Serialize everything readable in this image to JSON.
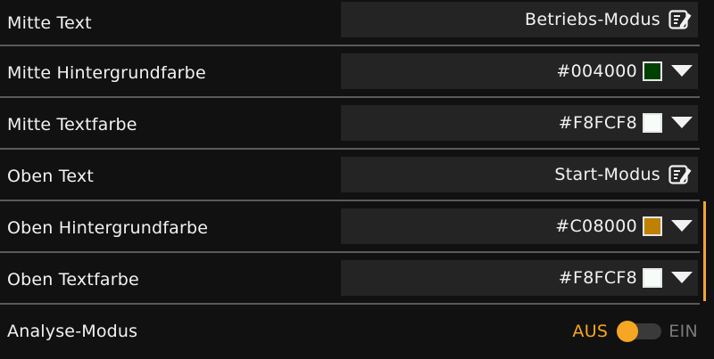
{
  "rows": [
    {
      "label": "Mitte Text",
      "value": "Betriebs-Modus",
      "kind": "text",
      "icon": "edit-icon"
    },
    {
      "label": "Mitte Hintergrundfarbe",
      "value": "#004000",
      "kind": "color",
      "color": "#004000",
      "icon": "dropdown-triangle-icon"
    },
    {
      "label": "Mitte Textfarbe",
      "value": "#F8FCF8",
      "kind": "color",
      "color": "#F8FCF8",
      "icon": "dropdown-triangle-icon"
    },
    {
      "label": "Oben Text",
      "value": "Start-Modus",
      "kind": "text",
      "icon": "edit-icon"
    },
    {
      "label": "Oben Hintergrundfarbe",
      "value": "#C08000",
      "kind": "color",
      "color": "#C08000",
      "icon": "dropdown-triangle-icon"
    },
    {
      "label": "Oben Textfarbe",
      "value": "#F8FCF8",
      "kind": "color",
      "color": "#F8FCF8",
      "icon": "dropdown-triangle-icon"
    }
  ],
  "analysis": {
    "label": "Analyse-Modus",
    "off_label": "AUS",
    "on_label": "EIN",
    "state": "off"
  },
  "colors": {
    "background": "#111111",
    "field": "#242424",
    "accent": "#F5A623",
    "divider": "#5A5A5A"
  }
}
